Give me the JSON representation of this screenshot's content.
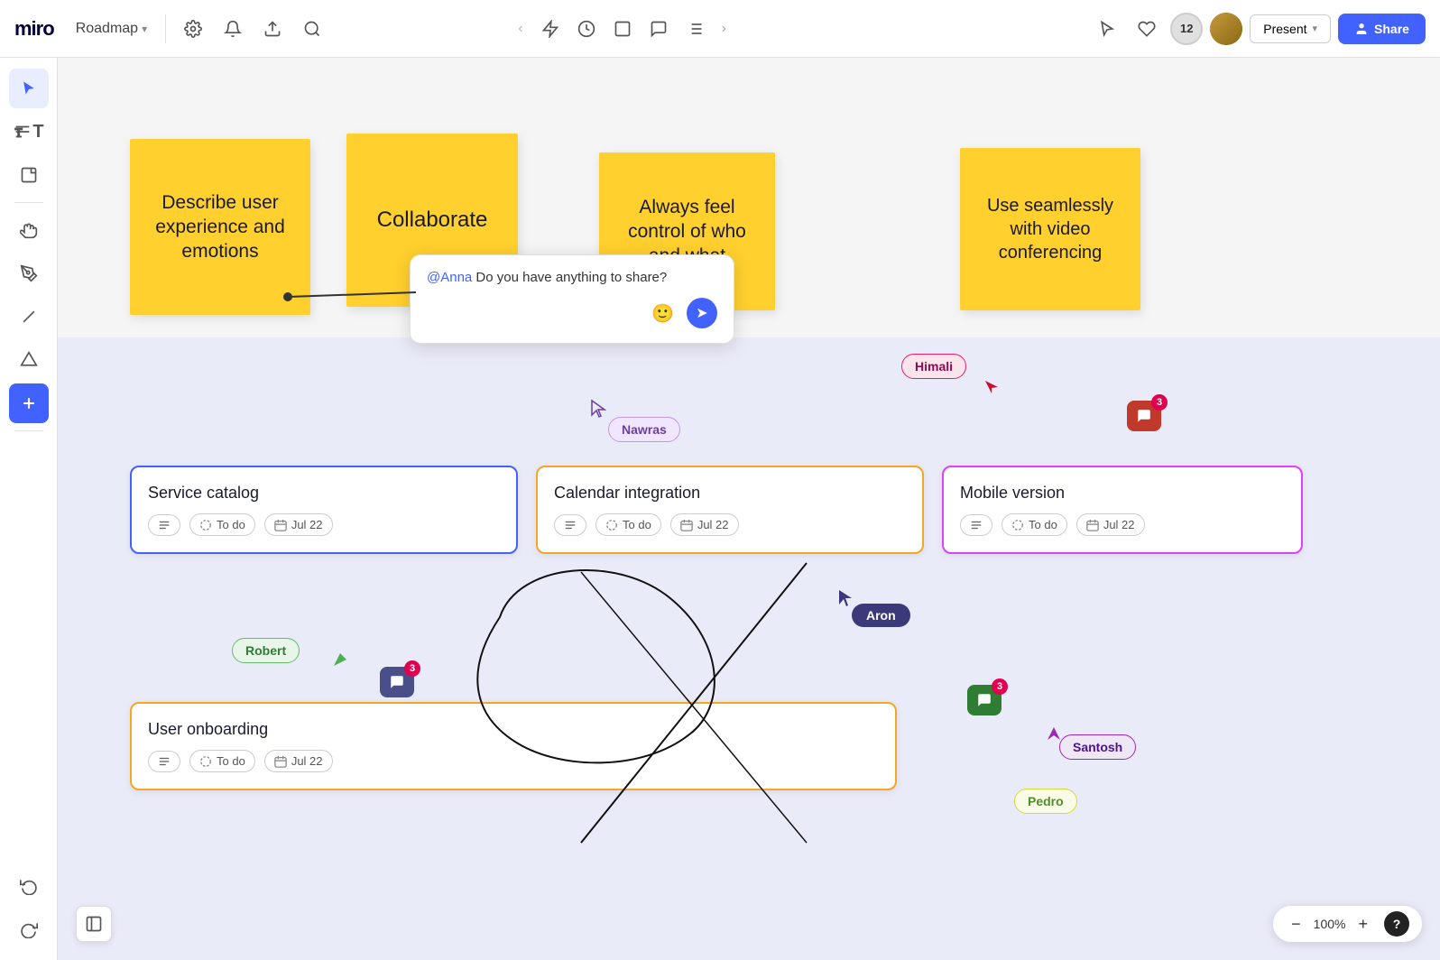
{
  "app": {
    "logo": "miro",
    "board_name": "Roadmap",
    "chevron": "▾"
  },
  "topbar": {
    "settings_icon": "⚙",
    "bell_icon": "🔔",
    "upload_icon": "↑",
    "search_icon": "🔍",
    "back_icon": "‹",
    "lightning_icon": "⚡",
    "timer_icon": "⏱",
    "frame_icon": "⬜",
    "comment_icon": "💬",
    "list_icon": "≡",
    "more_icon": "›",
    "collab_count": "12",
    "present_label": "Present",
    "present_chevron": "▾",
    "share_icon": "👤",
    "share_label": "Share"
  },
  "sidebar": {
    "select_icon": "▲",
    "text_icon": "T",
    "note_icon": "☐",
    "hand_icon": "✋",
    "pen_icon": "✎",
    "line_icon": "/",
    "arch_icon": "∧",
    "plus_icon": "+",
    "undo_icon": "↩",
    "redo_icon": "↪",
    "panel_icon": "⊟"
  },
  "stickies": [
    {
      "id": "s1",
      "text": "Describe user experience and emotions",
      "color": "yellow"
    },
    {
      "id": "s2",
      "text": "Collaborate",
      "color": "yellow"
    },
    {
      "id": "s3",
      "text": "Always feel control of who and what",
      "color": "yellow"
    },
    {
      "id": "s4",
      "text": "Use seamlessly with video conferencing",
      "color": "yellow"
    }
  ],
  "comment": {
    "mention": "@Anna",
    "text": " Do you have anything to share?",
    "emoji_icon": "🙂",
    "send_icon": "➤"
  },
  "cards": [
    {
      "id": "c1",
      "title": "Service catalog",
      "border_color": "#4262ff",
      "status": "To do",
      "date": "Jul 22"
    },
    {
      "id": "c2",
      "title": "Calendar integration",
      "border_color": "#f5a623",
      "status": "To do",
      "date": "Jul 22"
    },
    {
      "id": "c3",
      "title": "Mobile version",
      "border_color": "#e040fb",
      "status": "To do",
      "date": "Jul 22"
    },
    {
      "id": "c4",
      "title": "User onboarding",
      "border_color": "#f5a623",
      "status": "To do",
      "date": "Jul 22"
    }
  ],
  "cursors": [
    {
      "name": "Nawras",
      "bg": "#f5e6ff",
      "border": "#c9a0f0",
      "color": "#6b3fa0"
    },
    {
      "name": "Himali",
      "bg": "#fce4ec",
      "border": "#e91e63",
      "color": "#880e4f"
    },
    {
      "name": "Aron",
      "bg": "#3a3a7a",
      "border": "#3a3a7a",
      "color": "#fff"
    },
    {
      "name": "Robert",
      "bg": "#e8f5e9",
      "border": "#66bb6a",
      "color": "#2e7d32"
    },
    {
      "name": "Santosh",
      "bg": "#ede7f6",
      "border": "#9c27b0",
      "color": "#4a148c"
    },
    {
      "name": "Pedro",
      "bg": "#f9fbe7",
      "border": "#cddc39",
      "color": "#558b2f"
    }
  ],
  "comments_icons": [
    {
      "count": "3",
      "type": "red"
    },
    {
      "count": "3",
      "type": "purple"
    },
    {
      "count": "3",
      "type": "green"
    }
  ],
  "zoom": {
    "minus": "−",
    "percent": "100%",
    "plus": "+",
    "help": "?"
  }
}
